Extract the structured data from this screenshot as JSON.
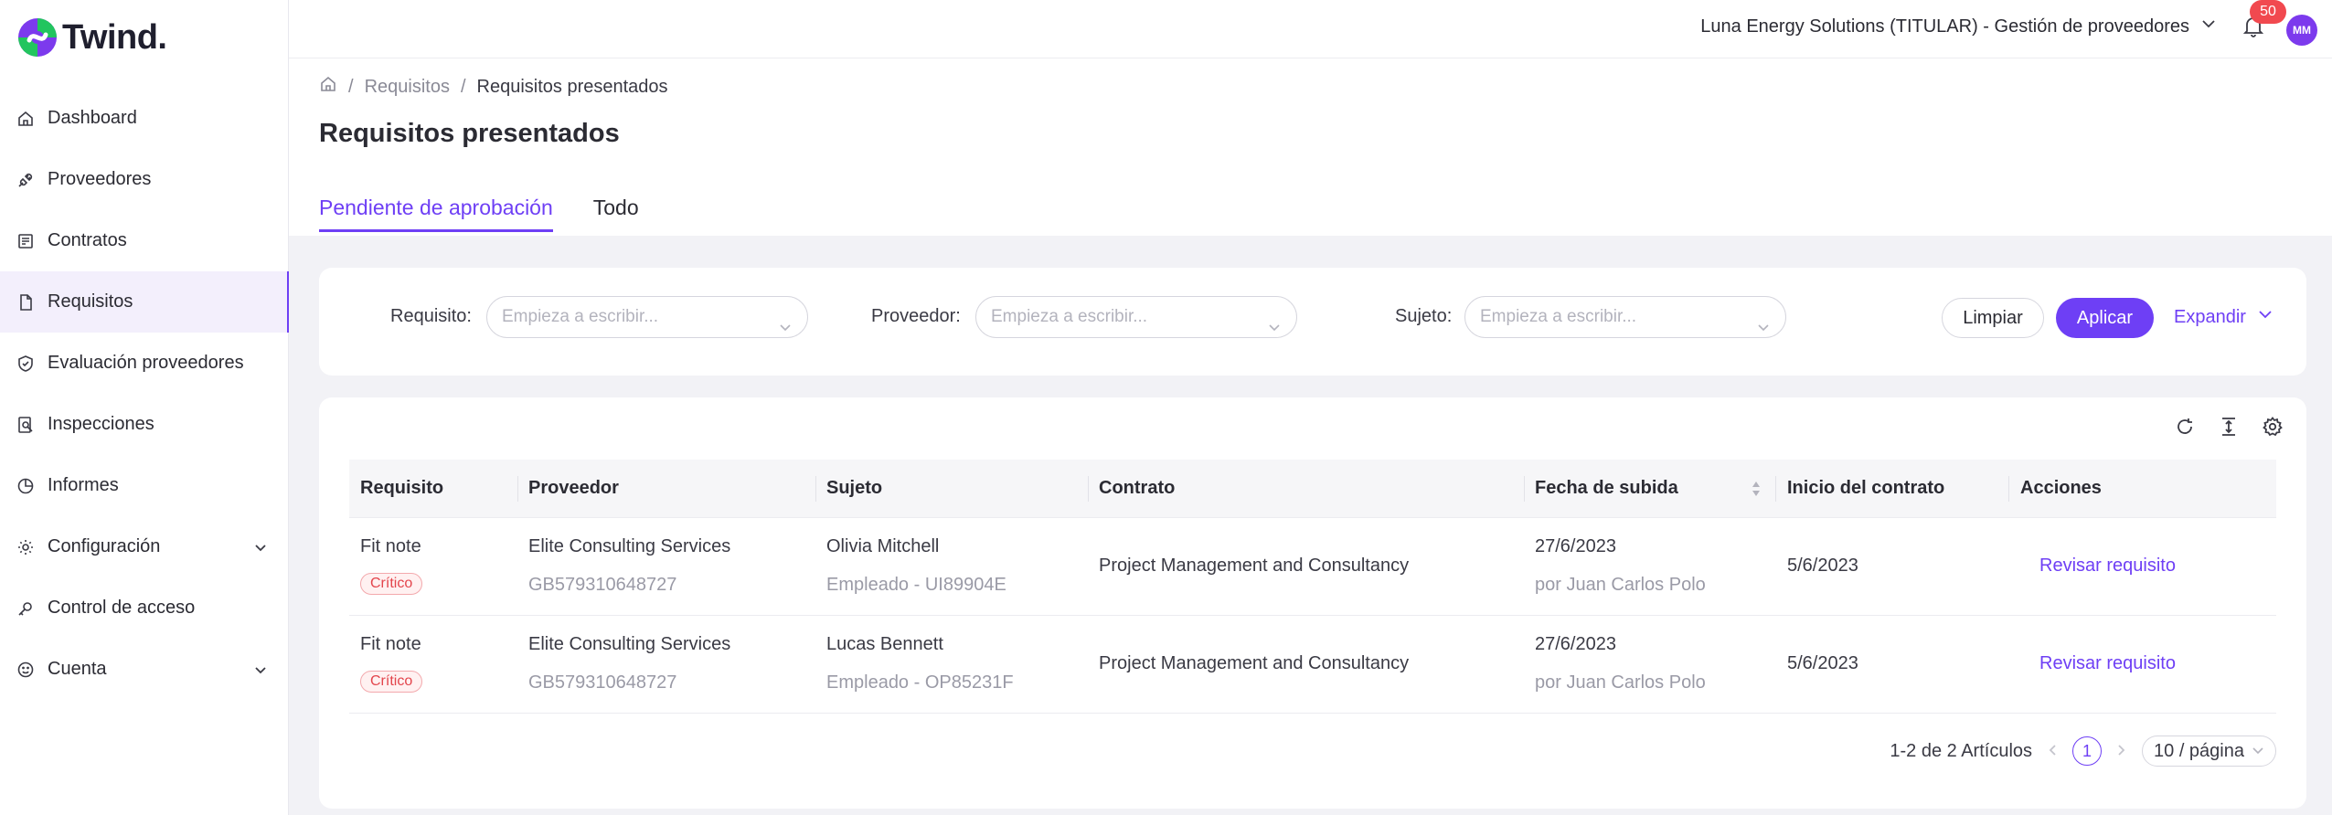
{
  "brand": {
    "name": "Twind.",
    "accent": "#6e3ff5"
  },
  "sidebar": {
    "items": [
      {
        "label": "Dashboard",
        "icon": "home-icon"
      },
      {
        "label": "Proveedores",
        "icon": "plug-icon"
      },
      {
        "label": "Contratos",
        "icon": "contract-icon"
      },
      {
        "label": "Requisitos",
        "icon": "document-icon",
        "active": true
      },
      {
        "label": "Evaluación proveedores",
        "icon": "shield-check-icon"
      },
      {
        "label": "Inspecciones",
        "icon": "inspection-icon"
      },
      {
        "label": "Informes",
        "icon": "pie-chart-icon"
      },
      {
        "label": "Configuración",
        "icon": "gear-icon",
        "expandable": true
      },
      {
        "label": "Control de acceso",
        "icon": "key-icon"
      },
      {
        "label": "Cuenta",
        "icon": "smiley-icon",
        "expandable": true
      }
    ]
  },
  "topbar": {
    "company": "Luna Energy Solutions (TITULAR) - Gestión de proveedores",
    "notifications": "50",
    "avatar": "MM"
  },
  "breadcrumb": {
    "level1": "Requisitos",
    "current": "Requisitos presentados"
  },
  "page": {
    "title": "Requisitos presentados"
  },
  "tabs": [
    {
      "label": "Pendiente de aprobación",
      "active": true
    },
    {
      "label": "Todo"
    }
  ],
  "filters": {
    "requisito_label": "Requisito",
    "proveedor_label": "Proveedor",
    "sujeto_label": "Sujeto",
    "colon": ":",
    "placeholder": "Empieza a escribir...",
    "clear": "Limpiar",
    "apply": "Aplicar",
    "expand": "Expandir"
  },
  "table": {
    "headers": {
      "requisito": "Requisito",
      "proveedor": "Proveedor",
      "sujeto": "Sujeto",
      "contrato": "Contrato",
      "fecha": "Fecha de subida",
      "inicio": "Inicio del contrato",
      "acciones": "Acciones"
    },
    "rows": [
      {
        "requisito": "Fit note",
        "tag": "Crítico",
        "proveedor": "Elite Consulting Services",
        "proveedor_id": "GB579310648727",
        "sujeto": "Olivia Mitchell",
        "sujeto_sub": "Empleado - UI89904E",
        "contrato": "Project Management and Consultancy",
        "fecha": "27/6/2023",
        "fecha_sub": "por Juan Carlos Polo",
        "inicio": "5/6/2023",
        "accion": "Revisar requisito"
      },
      {
        "requisito": "Fit note",
        "tag": "Crítico",
        "proveedor": "Elite Consulting Services",
        "proveedor_id": "GB579310648727",
        "sujeto": "Lucas Bennett",
        "sujeto_sub": "Empleado - OP85231F",
        "contrato": "Project Management and Consultancy",
        "fecha": "27/6/2023",
        "fecha_sub": "por Juan Carlos Polo",
        "inicio": "5/6/2023",
        "accion": "Revisar requisito"
      }
    ]
  },
  "pagination": {
    "summary": "1-2 de 2 Artículos",
    "page": "1",
    "page_size": "10 / página"
  }
}
